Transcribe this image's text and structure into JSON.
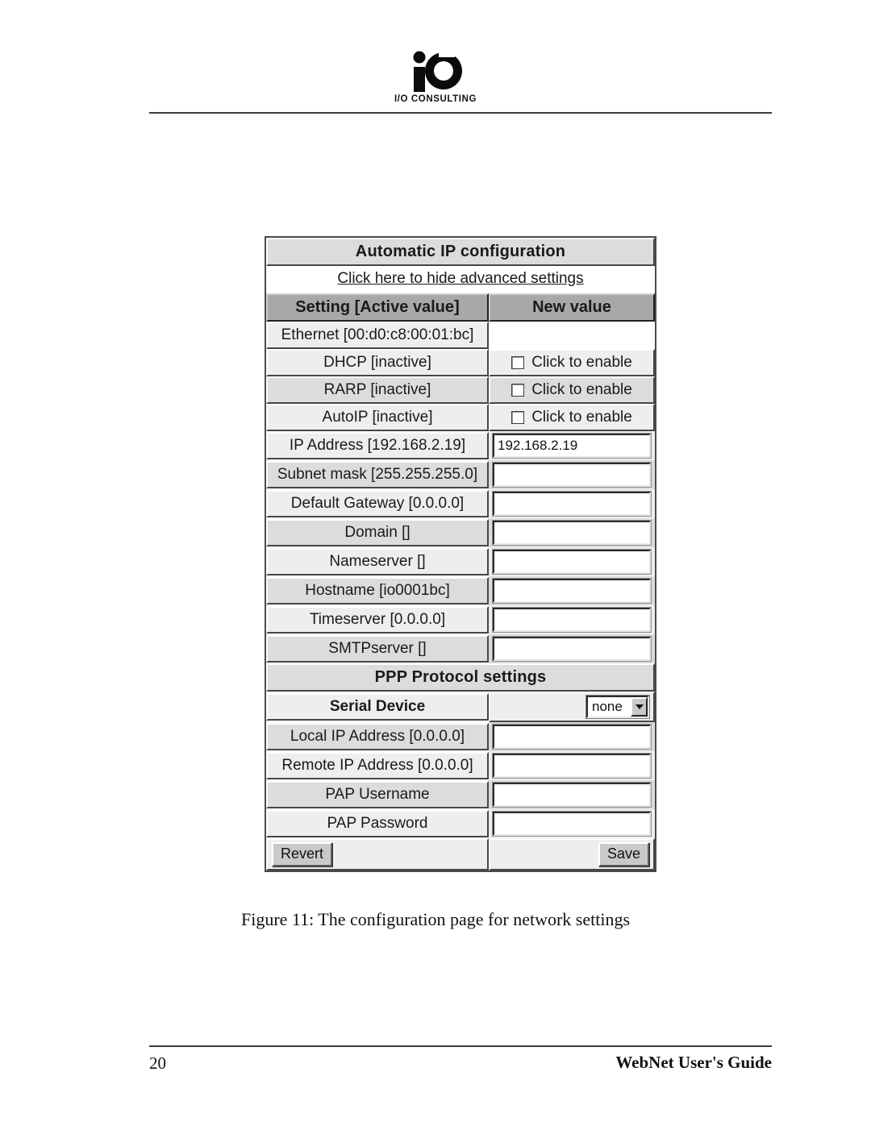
{
  "page": {
    "logo_text": "I/O CONSULTING",
    "logo_icon": "io-consulting-logo",
    "caption": "Figure 11: The configuration page for network settings",
    "footer_page_number": "20",
    "footer_title": "WebNet User's Guide"
  },
  "config": {
    "banner_title": "Automatic IP configuration",
    "advanced_link": "Click here to hide advanced settings",
    "column_headers": {
      "setting": "Setting [Active value]",
      "value": "New value"
    },
    "ppp_section_title": "PPP Protocol settings",
    "checkbox_label": "Click to enable",
    "rows": [
      {
        "label": "Ethernet [00:d0:c8:00:01:bc]",
        "type": "readonly",
        "value": ""
      },
      {
        "label": "DHCP [inactive]",
        "type": "checkbox",
        "value": ""
      },
      {
        "label": "RARP [inactive]",
        "type": "checkbox",
        "value": ""
      },
      {
        "label": "AutoIP [inactive]",
        "type": "checkbox",
        "value": ""
      },
      {
        "label": "IP Address [192.168.2.19]",
        "type": "text",
        "value": "192.168.2.19"
      },
      {
        "label": "Subnet mask [255.255.255.0]",
        "type": "text",
        "value": ""
      },
      {
        "label": "Default Gateway [0.0.0.0]",
        "type": "text",
        "value": ""
      },
      {
        "label": "Domain []",
        "type": "text",
        "value": ""
      },
      {
        "label": "Nameserver []",
        "type": "text",
        "value": ""
      },
      {
        "label": "Hostname [io0001bc]",
        "type": "text",
        "value": ""
      },
      {
        "label": "Timeserver [0.0.0.0]",
        "type": "text",
        "value": ""
      },
      {
        "label": "SMTPserver []",
        "type": "text",
        "value": ""
      }
    ],
    "ppp_rows": [
      {
        "label": "Serial Device",
        "type": "select",
        "value": "none"
      },
      {
        "label": "Local IP Address [0.0.0.0]",
        "type": "text",
        "value": ""
      },
      {
        "label": "Remote IP Address [0.0.0.0]",
        "type": "text",
        "value": ""
      },
      {
        "label": "PAP Username",
        "type": "text",
        "value": ""
      },
      {
        "label": "PAP Password",
        "type": "text",
        "value": ""
      }
    ],
    "buttons": {
      "revert": "Revert",
      "save": "Save"
    }
  }
}
